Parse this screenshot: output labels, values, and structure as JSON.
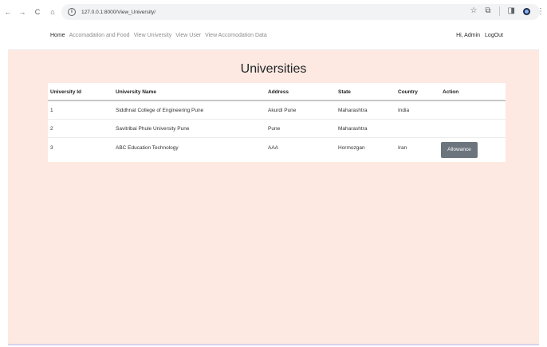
{
  "browser": {
    "url": "127.0.0.1:8000/View_University/",
    "nav": {
      "back": "←",
      "forward": "→",
      "reload": "C",
      "home": "⌂"
    },
    "icons": {
      "info": "i",
      "star": "☆",
      "extension": "⧉",
      "sidepanel": "◨",
      "menu": "⋮"
    }
  },
  "navbar": {
    "links": [
      "Home",
      "Accomadation and Food",
      "View University",
      "View User",
      "View Accomodation Data"
    ],
    "greeting": "Hi, Admin",
    "logout": "LogOut"
  },
  "page": {
    "title": "Universities",
    "background": "#fde9e1"
  },
  "table": {
    "headers": [
      "University Id",
      "University Name",
      "Address",
      "State",
      "Country",
      "Action"
    ],
    "rows": [
      {
        "id": "1",
        "name": "Siddhnat College of Engineering Pune",
        "address": "Akurdi Pune",
        "state": "Maharashtra",
        "country": "India",
        "action": ""
      },
      {
        "id": "2",
        "name": "Savitribai Phule University Pune",
        "address": "Pune",
        "state": "Maharashtra",
        "country": "",
        "action": ""
      },
      {
        "id": "3",
        "name": "ABC Education Technology",
        "address": "AAA",
        "state": "Hormozgan",
        "country": "Iran",
        "action": "Allowance"
      }
    ]
  }
}
